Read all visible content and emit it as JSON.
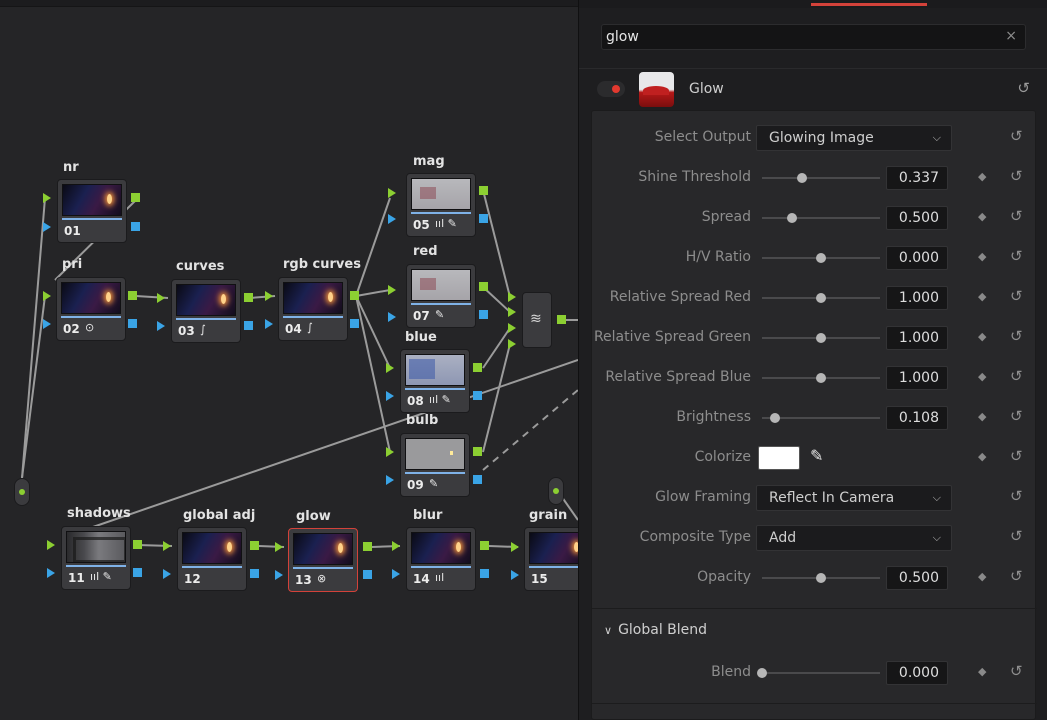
{
  "node_editor": {
    "nodes": [
      {
        "id": "01",
        "label": "nr",
        "tool": ""
      },
      {
        "id": "02",
        "label": "pri",
        "tool": "⊙"
      },
      {
        "id": "03",
        "label": "curves",
        "tool": "∫"
      },
      {
        "id": "04",
        "label": "rgb curves",
        "tool": "∫"
      },
      {
        "id": "05",
        "label": "mag",
        "tool": "ııl ✎"
      },
      {
        "id": "07",
        "label": "red",
        "tool": "✎"
      },
      {
        "id": "08",
        "label": "blue",
        "tool": "ııl ✎"
      },
      {
        "id": "09",
        "label": "bulb",
        "tool": "✎"
      },
      {
        "id": "11",
        "label": "shadows",
        "tool": "ııl ✎"
      },
      {
        "id": "12",
        "label": "global adj",
        "tool": ""
      },
      {
        "id": "13",
        "label": "glow",
        "tool": "⊗"
      },
      {
        "id": "14",
        "label": "blur",
        "tool": "ııl"
      },
      {
        "id": "15",
        "label": "grain",
        "tool": ""
      }
    ],
    "mixer_icon": "layers-icon"
  },
  "inspector": {
    "search": {
      "value": "glow",
      "clear_glyph": "×"
    },
    "effect": {
      "name": "Glow",
      "enabled": true,
      "accent": "#e2392f"
    },
    "select_output": {
      "label": "Select Output",
      "value": "Glowing Image"
    },
    "params": [
      {
        "label": "Shine Threshold",
        "value": "0.337",
        "level": 0.337
      },
      {
        "label": "Spread",
        "value": "0.500",
        "level": 0.25
      },
      {
        "label": "H/V Ratio",
        "value": "0.000",
        "level": 0.5
      },
      {
        "label": "Relative Spread Red",
        "value": "1.000",
        "level": 0.5
      },
      {
        "label": "Relative Spread Green",
        "value": "1.000",
        "level": 0.5
      },
      {
        "label": "Relative Spread Blue",
        "value": "1.000",
        "level": 0.5
      },
      {
        "label": "Brightness",
        "value": "0.108",
        "level": 0.11
      }
    ],
    "colorize": {
      "label": "Colorize",
      "color": "#ffffff"
    },
    "glow_framing": {
      "label": "Glow Framing",
      "value": "Reflect In Camera"
    },
    "composite_type": {
      "label": "Composite Type",
      "value": "Add"
    },
    "opacity": {
      "label": "Opacity",
      "value": "0.500",
      "level": 0.5
    },
    "global_blend": {
      "title": "Global Blend",
      "blend": {
        "label": "Blend",
        "value": "0.000",
        "level": 0.0
      }
    }
  }
}
